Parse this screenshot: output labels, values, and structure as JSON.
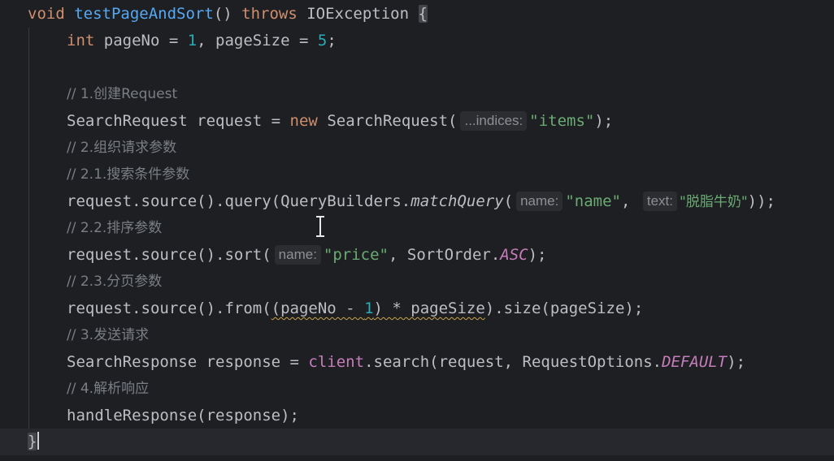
{
  "code": {
    "l1": {
      "kw_void": "void",
      "method": "testPageAndSort",
      "paren": "() ",
      "kw_throws": "throws",
      "exc": " IOException ",
      "brace": "{"
    },
    "l2": {
      "kw_int": "int",
      "a": " pageNo = ",
      "n1": "1",
      "b": ", pageSize = ",
      "n5": "5",
      "c": ";"
    },
    "l4": {
      "comment": "// 1.创建Request"
    },
    "l5": {
      "a": "SearchRequest request = ",
      "kw_new": "new",
      "b": " SearchRequest(",
      "hint": "...indices:",
      "str": "\"items\"",
      "c": ");"
    },
    "l6": {
      "comment": "// 2.组织请求参数"
    },
    "l7": {
      "comment": "// 2.1.搜索条件参数"
    },
    "l8": {
      "a": "request.source().query(QueryBuilders.",
      "method": "matchQuery",
      "b": "(",
      "hint1": "name:",
      "str1": "\"name\"",
      "c": ", ",
      "hint2": "text:",
      "str2": "\"脱脂牛奶\"",
      "d": "));"
    },
    "l9": {
      "comment": "// 2.2.排序参数"
    },
    "l10": {
      "a": "request.source().sort(",
      "hint": "name:",
      "str": "\"price\"",
      "b": ", SortOrder.",
      "const": "ASC",
      "c": ");"
    },
    "l11": {
      "comment": "// 2.3.分页参数"
    },
    "l12": {
      "a": "request.source().from(",
      "warn_a": "(pageNo - ",
      "n1": "1",
      "warn_b": ") * pageSize",
      "b": ").size(pageSize);"
    },
    "l13": {
      "comment": "// 3.发送请求"
    },
    "l14": {
      "a": "SearchResponse response = ",
      "field": "client",
      "b": ".search(request, RequestOptions.",
      "const": "DEFAULT",
      "c": ");"
    },
    "l15": {
      "comment": "// 4.解析响应"
    },
    "l16": {
      "a": "handleResponse(response);"
    },
    "l17": {
      "brace": "}"
    }
  }
}
